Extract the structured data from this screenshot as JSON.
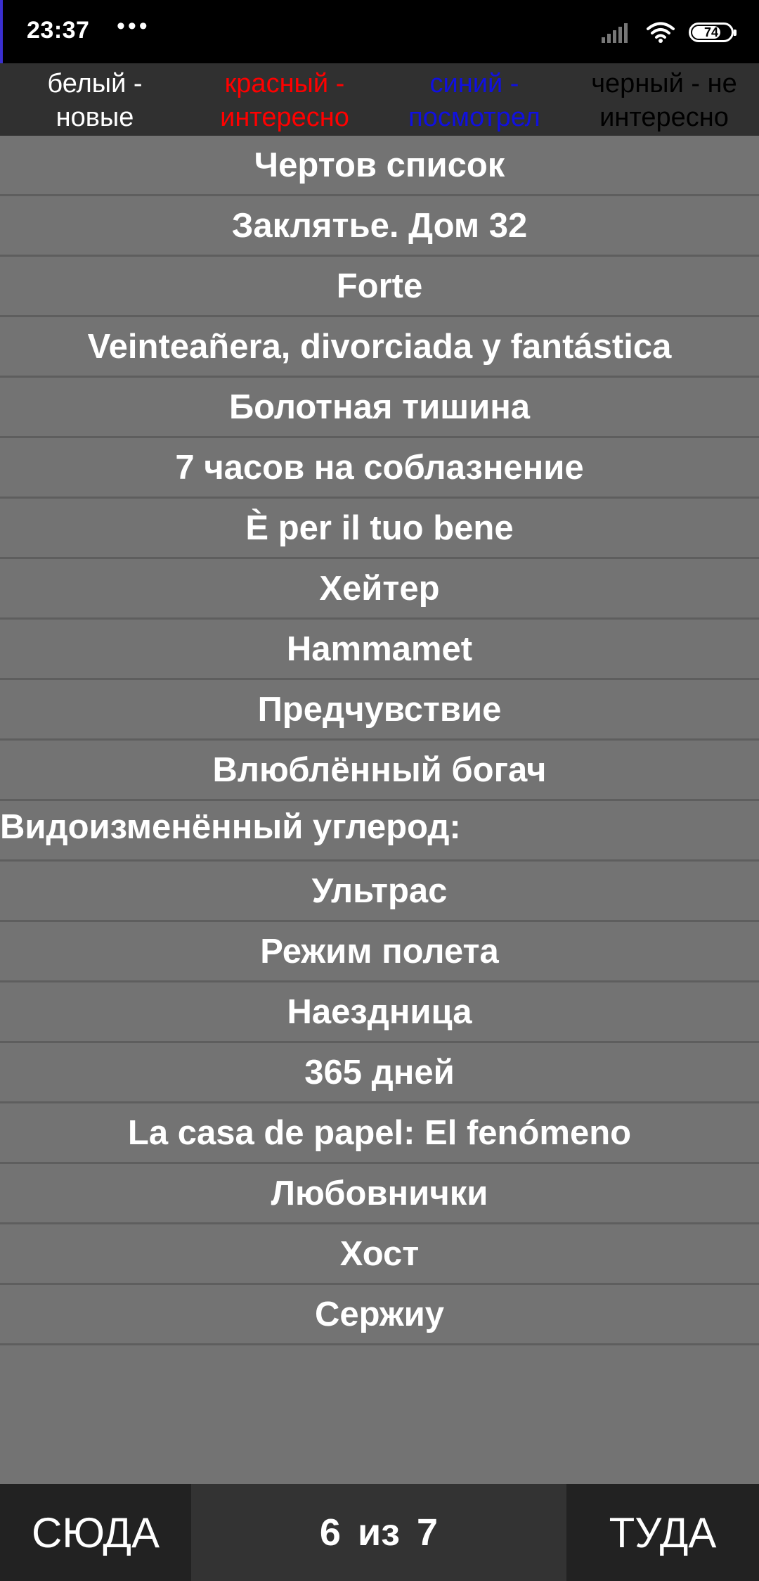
{
  "status_bar": {
    "time": "23:37",
    "more": "•••",
    "battery": {
      "level_text": "74",
      "level": 0.74
    },
    "icons": [
      "signal-icon",
      "wifi-icon",
      "battery-icon"
    ]
  },
  "legend": [
    {
      "line1": "белый -",
      "line2": "новые",
      "color": "#ffffff"
    },
    {
      "line1": "красный -",
      "line2": "интересно",
      "color": "#ff0000"
    },
    {
      "line1": "синий -",
      "line2": "посмотрел",
      "color": "#1010e0"
    },
    {
      "line1": "черный - не",
      "line2": "интересно",
      "color": "#000000"
    }
  ],
  "movies": [
    "Чертов список",
    "Заклятье. Дом 32",
    "Forte",
    "Veinteañera, divorciada y fantástica",
    "Болотная тишина",
    "7 часов на соблазнение",
    "È per il tuo bene",
    "Хейтер",
    "Hammamet",
    "Предчувствие",
    "Влюблённый богач",
    "Видоизменённый углерод:",
    "Ультрас",
    "Режим полета",
    "Наездница",
    "365 дней",
    "La casa de papel: El fenómeno",
    "Любовнички",
    "Хост",
    "Сержиу"
  ],
  "nav": {
    "prev_label": "СЮДА",
    "next_label": "ТУДА",
    "page_current": "6",
    "page_sep": "из",
    "page_total": "7"
  },
  "colors": {
    "background": "#737373",
    "legend_bg": "#303030",
    "row_divider": "#5e5e5e",
    "nav_button_bg": "#222222",
    "pager_bg": "#333333"
  }
}
